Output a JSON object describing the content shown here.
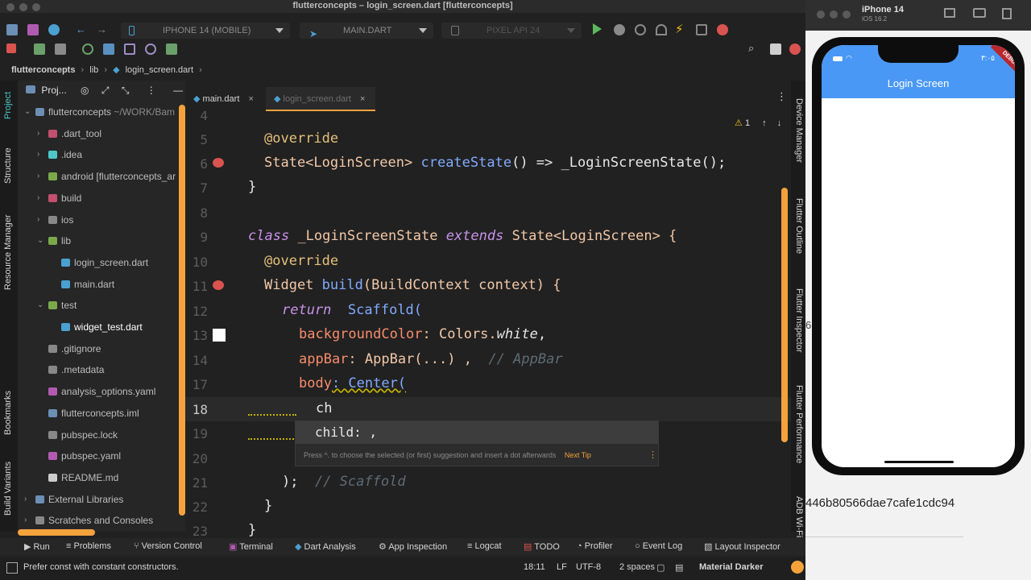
{
  "window": {
    "title": "flutterconcepts – login_screen.dart [flutterconcepts]"
  },
  "toolbar": {
    "device_select": "IPHONE 14 (MOBILE)",
    "run_config": "MAIN.DART",
    "emulator_select": "PIXEL API 24"
  },
  "breadcrumb": [
    "flutterconcepts",
    "lib",
    "login_screen.dart"
  ],
  "left_strip": [
    "Project",
    "Structure",
    "Resource Manager",
    "Bookmarks",
    "Build Variants"
  ],
  "project": {
    "header": "Proj...",
    "tree": [
      {
        "label": "flutterconcepts",
        "extra": "~/WORK/Bam",
        "indent": 0,
        "chev": "v"
      },
      {
        "label": ".dart_tool",
        "indent": 1,
        "chev": ">"
      },
      {
        "label": ".idea",
        "indent": 1,
        "chev": ">"
      },
      {
        "label": "android [flutterconcepts_ar",
        "indent": 1,
        "chev": ">"
      },
      {
        "label": "build",
        "indent": 1,
        "chev": ">"
      },
      {
        "label": "ios",
        "indent": 1,
        "chev": ">"
      },
      {
        "label": "lib",
        "indent": 1,
        "chev": "v"
      },
      {
        "label": "login_screen.dart",
        "indent": 2,
        "chev": ""
      },
      {
        "label": "main.dart",
        "indent": 2,
        "chev": ""
      },
      {
        "label": "test",
        "indent": 1,
        "chev": "v"
      },
      {
        "label": "widget_test.dart",
        "indent": 2,
        "chev": ""
      },
      {
        "label": ".gitignore",
        "indent": 1,
        "chev": ""
      },
      {
        "label": ".metadata",
        "indent": 1,
        "chev": ""
      },
      {
        "label": "analysis_options.yaml",
        "indent": 1,
        "chev": ""
      },
      {
        "label": "flutterconcepts.iml",
        "indent": 1,
        "chev": ""
      },
      {
        "label": "pubspec.lock",
        "indent": 1,
        "chev": ""
      },
      {
        "label": "pubspec.yaml",
        "indent": 1,
        "chev": ""
      },
      {
        "label": "README.md",
        "indent": 1,
        "chev": ""
      },
      {
        "label": "External Libraries",
        "indent": 0,
        "chev": ">"
      },
      {
        "label": "Scratches and Consoles",
        "indent": 0,
        "chev": ">"
      }
    ]
  },
  "tabs": [
    {
      "label": "main.dart",
      "close": "×"
    },
    {
      "label": "login_screen.dart",
      "close": "×"
    }
  ],
  "editor": {
    "line_numbers": [
      "4",
      "5",
      "6",
      "7",
      "8",
      "9",
      "10",
      "11",
      "12",
      "13",
      "14",
      "17",
      "18",
      "19",
      "20",
      "21",
      "22",
      "23"
    ],
    "warning_count": "1",
    "lines": {
      "l5a": "@override",
      "l6a": "State<LoginScreen>",
      "l6b": "createState",
      "l6c": "() => _LoginScreenState();",
      "l7": "}",
      "l9a": "class",
      "l9b": "_LoginScreenState",
      "l9c": "extends",
      "l9d": "State<LoginScreen> {",
      "l10": "@override",
      "l11a": "Widget",
      "l11b": "build",
      "l11c": "(BuildContext context) {",
      "l12a": "return",
      "l12b": "Scaffold(",
      "l13a": "backgroundColor",
      "l13b": ": Colors.",
      "l13c": "white",
      "l13d": ",",
      "l14a": "appBar",
      "l14b": ": AppBar(...) ,",
      "l14c": "// AppBar",
      "l17a": "body",
      "l17b": ": Center(",
      "l18": "ch",
      "l21a": ");",
      "l21b": "// Scaffold",
      "l22": "}",
      "l23": "}"
    },
    "completion": {
      "item": "child: ,",
      "hint": "Press ^. to choose the selected (or first) suggestion and insert a dot afterwards",
      "next_tip": "Next Tip"
    }
  },
  "right_strip": [
    "Device Manager",
    "Flutter Outline",
    "Flutter Inspector",
    "Flutter Performance",
    "ADB Wi-Fi"
  ],
  "bottom_tools": [
    "Run",
    "Problems",
    "Version Control",
    "Terminal",
    "Dart Analysis",
    "App Inspection",
    "Logcat",
    "TODO",
    "Profiler",
    "Event Log",
    "Layout Inspector"
  ],
  "status": {
    "message": "Prefer const with constant constructors.",
    "position": "18:11",
    "line_sep": "LF",
    "encoding": "UTF-8",
    "indent": "2 spaces",
    "theme": "Material Darker"
  },
  "simulator": {
    "device": "iPhone 14",
    "os": "iOS 16.2",
    "app_title": "Login Screen",
    "status_time": "۳:۰۵",
    "debug_banner": "DEBUG",
    "side_text": "446b80566dae7cafe1cdc94",
    "side_num": "6"
  },
  "colors": {
    "accent": "#f5a23d",
    "appbar": "#4a98f5"
  }
}
